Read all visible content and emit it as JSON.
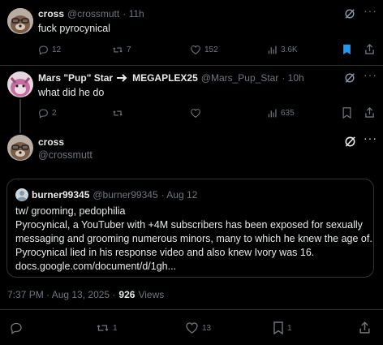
{
  "tweet1": {
    "name": "cross",
    "handle": "@crossmutt",
    "time": "· 11h",
    "text": "fuck pyrocynical",
    "replies": "12",
    "reposts": "7",
    "likes": "152",
    "views": "3.6K"
  },
  "tweet2": {
    "name": "Mars \"Pup\" Star",
    "name_badge": "MEGAPLEX25",
    "handle": "@Mars_Pup_Star",
    "time": "· 10h",
    "text": "what did he do",
    "replies": "2",
    "views": "635"
  },
  "main": {
    "name": "cross",
    "handle": "@crossmutt",
    "quote": {
      "name": "burner99345",
      "handle": "@burner99345",
      "time": "· Aug 12",
      "lines": [
        "tw/ grooming, pedophilia",
        "Pyrocynical, a YouTuber with +4M subscribers has been exposed for sexually",
        "messaging and grooming numerous minors, many to which he knew the age of.",
        "Pyrocynical lied in his response video and also knew Ivory was 16.",
        "docs.google.com/document/d/1gh..."
      ]
    },
    "timestamp": "7:37 PM · Aug 13, 2025 ·",
    "views_count": "926",
    "views_label": "Views",
    "reposts": "1",
    "likes": "13",
    "bookmarks": "1"
  },
  "colors": {
    "background": "#000000",
    "text": "#e7e9ea",
    "muted": "#71767b",
    "accent": "#1d9bf0",
    "divider": "#2f3336"
  }
}
